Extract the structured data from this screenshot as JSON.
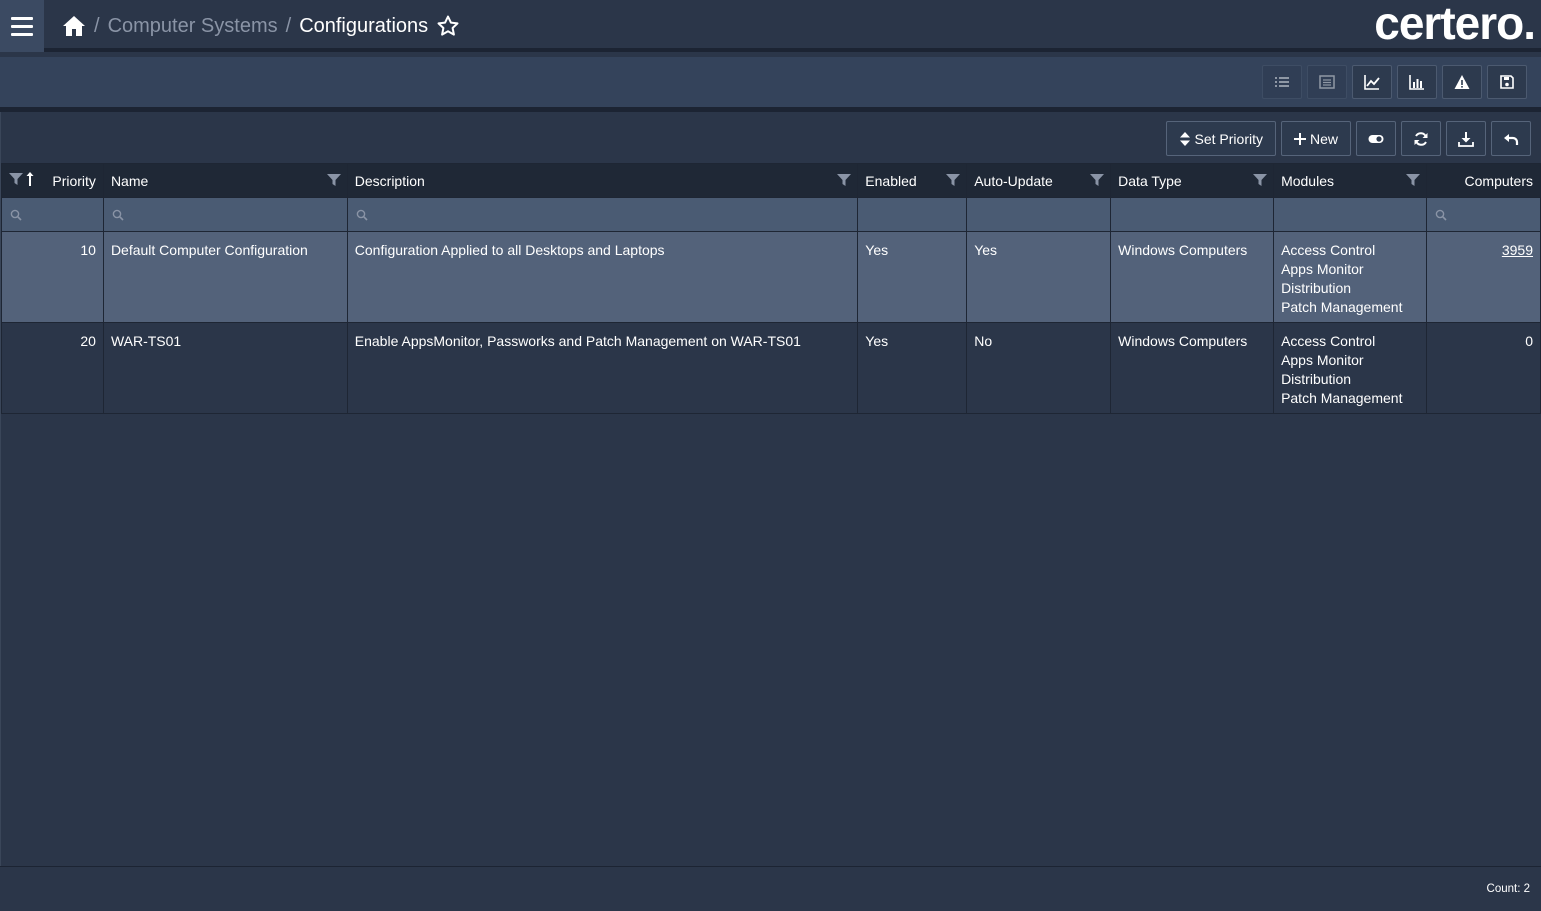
{
  "header": {
    "breadcrumb": {
      "parent": "Computer Systems",
      "separator": "/",
      "current": "Configurations"
    },
    "logo": "certero."
  },
  "toolbar_top": {
    "buttons": [
      "list-icon",
      "grid-view-icon",
      "line-chart-icon",
      "bar-chart-icon",
      "warning-icon",
      "save-icon"
    ]
  },
  "toolbar_grid": {
    "set_priority_label": "Set Priority",
    "new_label": "New",
    "icon_buttons": [
      "toggle-icon",
      "refresh-icon",
      "download-icon",
      "undo-icon"
    ]
  },
  "table": {
    "columns": [
      "Priority",
      "Name",
      "Description",
      "Enabled",
      "Auto-Update",
      "Data Type",
      "Modules",
      "Computers"
    ],
    "rows": [
      {
        "priority": "10",
        "name": "Default Computer Configuration",
        "description": "Configuration Applied to all Desktops and Laptops",
        "enabled": "Yes",
        "auto_update": "Yes",
        "data_type": "Windows Computers",
        "modules": [
          "Access Control",
          "Apps Monitor",
          "Distribution",
          "Patch Management"
        ],
        "computers": "3959"
      },
      {
        "priority": "20",
        "name": "WAR-TS01",
        "description": "Enable AppsMonitor, Passworks and Patch Management on WAR-TS01",
        "enabled": "Yes",
        "auto_update": "No",
        "data_type": "Windows Computers",
        "modules": [
          "Access Control",
          "Apps Monitor",
          "Distribution",
          "Patch Management"
        ],
        "computers": "0"
      }
    ]
  },
  "footer": {
    "count_label": "Count: 2"
  },
  "colors": {
    "background": "#2b3649",
    "header_row": "#1f2836",
    "filter_row": "#4a5b73",
    "selected_row": "#53627a"
  }
}
